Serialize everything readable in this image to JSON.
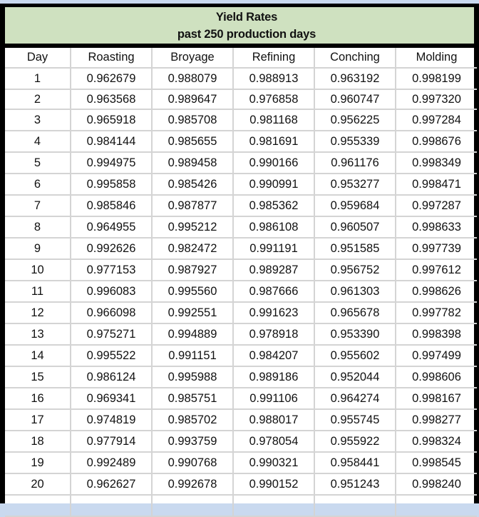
{
  "table": {
    "title": "Yield Rates",
    "subtitle": "past 250 production days",
    "columns": [
      "Day",
      "Roasting",
      "Broyage",
      "Refining",
      "Conching",
      "Molding"
    ],
    "rows": [
      [
        "1",
        "0.962679",
        "0.988079",
        "0.988913",
        "0.963192",
        "0.998199"
      ],
      [
        "2",
        "0.963568",
        "0.989647",
        "0.976858",
        "0.960747",
        "0.997320"
      ],
      [
        "3",
        "0.965918",
        "0.985708",
        "0.981168",
        "0.956225",
        "0.997284"
      ],
      [
        "4",
        "0.984144",
        "0.985655",
        "0.981691",
        "0.955339",
        "0.998676"
      ],
      [
        "5",
        "0.994975",
        "0.989458",
        "0.990166",
        "0.961176",
        "0.998349"
      ],
      [
        "6",
        "0.995858",
        "0.985426",
        "0.990991",
        "0.953277",
        "0.998471"
      ],
      [
        "7",
        "0.985846",
        "0.987877",
        "0.985362",
        "0.959684",
        "0.997287"
      ],
      [
        "8",
        "0.964955",
        "0.995212",
        "0.986108",
        "0.960507",
        "0.998633"
      ],
      [
        "9",
        "0.992626",
        "0.982472",
        "0.991191",
        "0.951585",
        "0.997739"
      ],
      [
        "10",
        "0.977153",
        "0.987927",
        "0.989287",
        "0.956752",
        "0.997612"
      ],
      [
        "11",
        "0.996083",
        "0.995560",
        "0.987666",
        "0.961303",
        "0.998626"
      ],
      [
        "12",
        "0.966098",
        "0.992551",
        "0.991623",
        "0.965678",
        "0.997782"
      ],
      [
        "13",
        "0.975271",
        "0.994889",
        "0.978918",
        "0.953390",
        "0.998398"
      ],
      [
        "14",
        "0.995522",
        "0.991151",
        "0.984207",
        "0.955602",
        "0.997499"
      ],
      [
        "15",
        "0.986124",
        "0.995988",
        "0.989186",
        "0.952044",
        "0.998606"
      ],
      [
        "16",
        "0.969341",
        "0.985751",
        "0.991106",
        "0.964274",
        "0.998167"
      ],
      [
        "17",
        "0.974819",
        "0.985702",
        "0.988017",
        "0.955745",
        "0.998277"
      ],
      [
        "18",
        "0.977914",
        "0.993759",
        "0.978054",
        "0.955922",
        "0.998324"
      ],
      [
        "19",
        "0.992489",
        "0.990768",
        "0.990321",
        "0.958441",
        "0.998545"
      ],
      [
        "20",
        "0.962627",
        "0.992678",
        "0.990152",
        "0.951243",
        "0.998240"
      ],
      [
        "",
        "",
        "",
        "",
        "",
        ""
      ]
    ]
  },
  "colors": {
    "background": "#c9d9ef",
    "title_band": "#cfe1c0",
    "border": "#000000",
    "grid": "#d4d4d4"
  }
}
